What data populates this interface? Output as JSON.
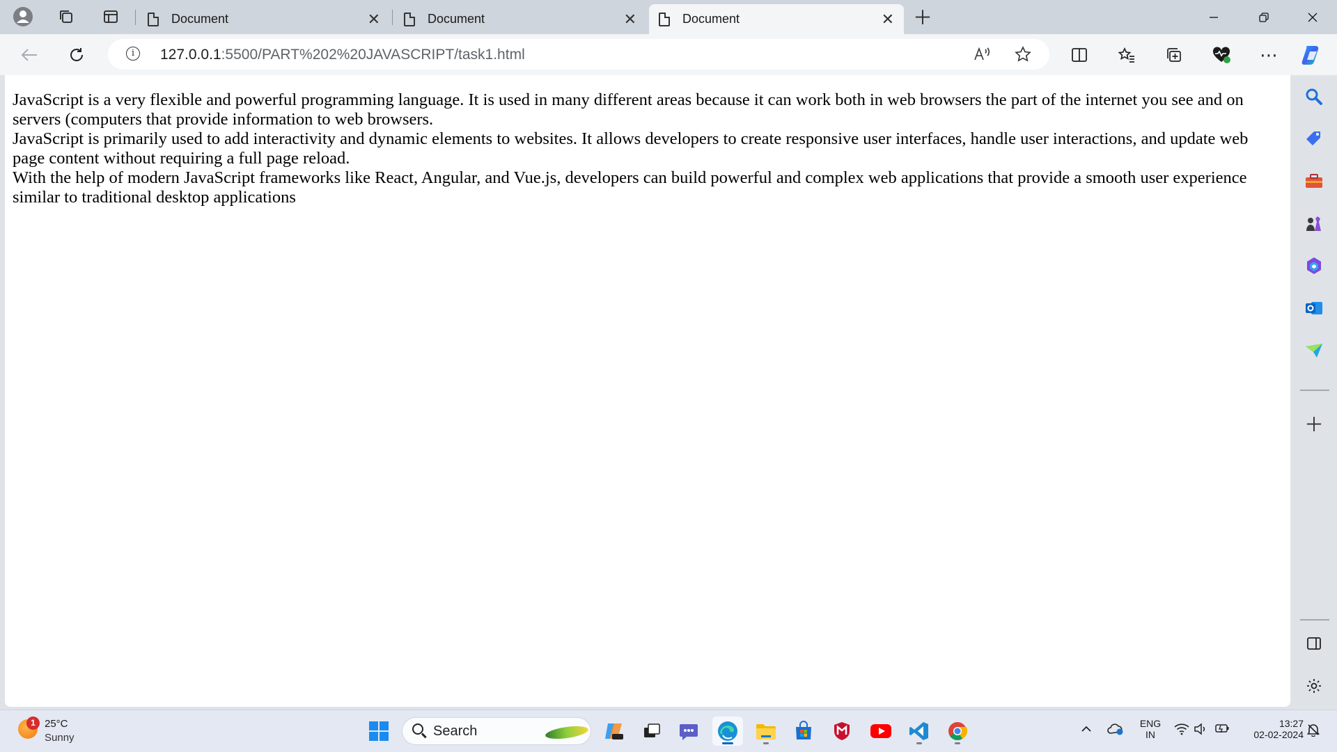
{
  "browser": {
    "tabs": [
      {
        "title": "Document",
        "active": false
      },
      {
        "title": "Document",
        "active": false
      },
      {
        "title": "Document",
        "active": true
      }
    ],
    "url_host": "127.0.0.1",
    "url_rest": ":5500/PART%202%20JAVASCRIPT/task1.html"
  },
  "page": {
    "paragraphs": [
      "JavaScript is a very flexible and powerful programming language. It is used in many different areas because it can work both in web browsers the part of the internet you see and on servers (computers that provide information to web browsers.",
      "JavaScript is primarily used to add interactivity and dynamic elements to websites. It allows developers to create responsive user interfaces, handle user interactions, and update web page content without requiring a full page reload.",
      "With the help of modern JavaScript frameworks like React, Angular, and Vue.js, developers can build powerful and complex web applications that provide a smooth user experience similar to traditional desktop applications"
    ]
  },
  "taskbar": {
    "weather_badge": "1",
    "temperature": "25°C",
    "condition": "Sunny",
    "search_label": "Search",
    "lang_top": "ENG",
    "lang_bottom": "IN",
    "time": "13:27",
    "date": "02-02-2024"
  },
  "colors": {
    "accent": "#0067c0",
    "tabstrip": "#cfd5dc",
    "toolbar": "#f3f5f7"
  }
}
